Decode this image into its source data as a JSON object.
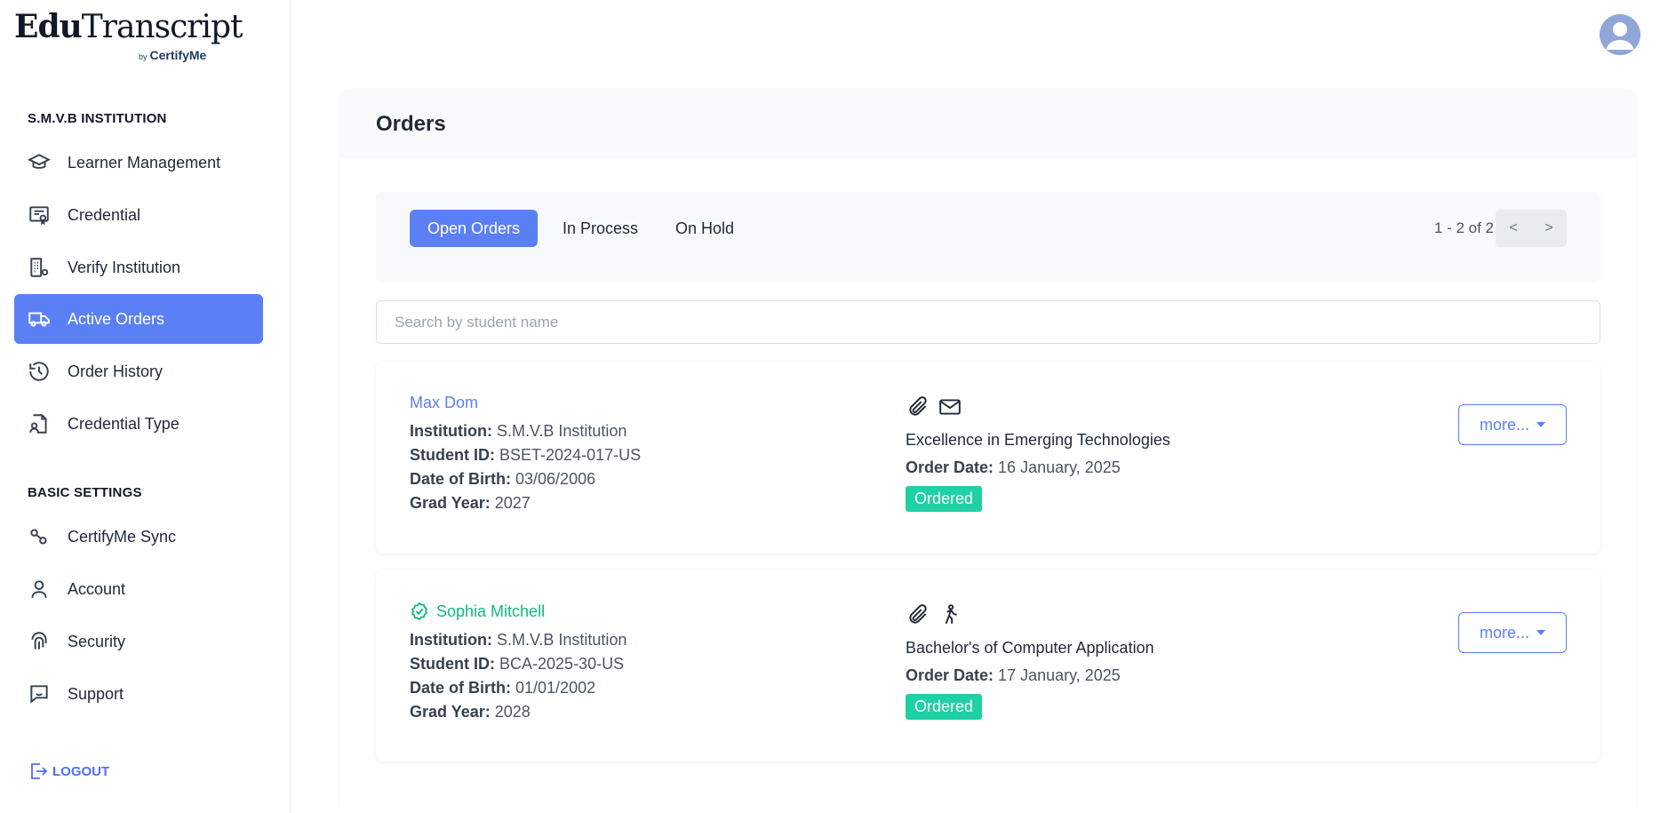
{
  "brand": {
    "name_part1": "Edu",
    "name_part2": "Transcript",
    "by_prefix": "by",
    "by_name": "CertifyMe"
  },
  "sidebar": {
    "institution_heading": "S.M.V.B INSTITUTION",
    "main_items": [
      {
        "label": "Learner Management",
        "icon": "graduation-cap-icon"
      },
      {
        "label": "Credential",
        "icon": "certificate-icon"
      },
      {
        "label": "Verify Institution",
        "icon": "building-gear-icon"
      },
      {
        "label": "Active Orders",
        "icon": "delivery-truck-icon",
        "active": true
      },
      {
        "label": "Order History",
        "icon": "history-icon"
      },
      {
        "label": "Credential Type",
        "icon": "file-user-icon"
      }
    ],
    "settings_heading": "BASIC SETTINGS",
    "settings_items": [
      {
        "label": "CertifyMe Sync",
        "icon": "sync-icon"
      },
      {
        "label": "Account",
        "icon": "user-icon"
      },
      {
        "label": "Security",
        "icon": "fingerprint-icon"
      },
      {
        "label": "Support",
        "icon": "chat-support-icon"
      }
    ],
    "logout_label": "LOGOUT"
  },
  "main": {
    "title": "Orders",
    "tabs": [
      {
        "label": "Open Orders",
        "active": true
      },
      {
        "label": "In Process",
        "active": false
      },
      {
        "label": "On Hold",
        "active": false
      }
    ],
    "pagination": {
      "text": "1 - 2 of 2",
      "prev": "<",
      "next": ">"
    },
    "search": {
      "placeholder": "Search by student name",
      "value": ""
    },
    "labels": {
      "institution": "Institution:",
      "student_id": "Student ID:",
      "dob": "Date of Birth:",
      "grad_year": "Grad Year:",
      "order_date": "Order Date:",
      "more": "more..."
    },
    "orders": [
      {
        "student_name": "Max Dom",
        "verified": false,
        "institution": "S.M.V.B Institution",
        "student_id": "BSET-2024-017-US",
        "dob": "03/06/2006",
        "grad_year": "2027",
        "icons": [
          "paperclip-icon",
          "mail-icon"
        ],
        "credential": "Excellence in Emerging Technologies",
        "order_date": "16 January, 2025",
        "status": "Ordered"
      },
      {
        "student_name": "Sophia Mitchell",
        "verified": true,
        "institution": "S.M.V.B Institution",
        "student_id": "BCA-2025-30-US",
        "dob": "01/01/2002",
        "grad_year": "2028",
        "icons": [
          "paperclip-icon",
          "walking-person-icon"
        ],
        "credential": "Bachelor's of Computer Application",
        "order_date": "17 January, 2025",
        "status": "Ordered"
      }
    ]
  },
  "colors": {
    "accent": "#5b7ff5",
    "status_green": "#1fd1a4",
    "verified_green": "#10b981"
  }
}
